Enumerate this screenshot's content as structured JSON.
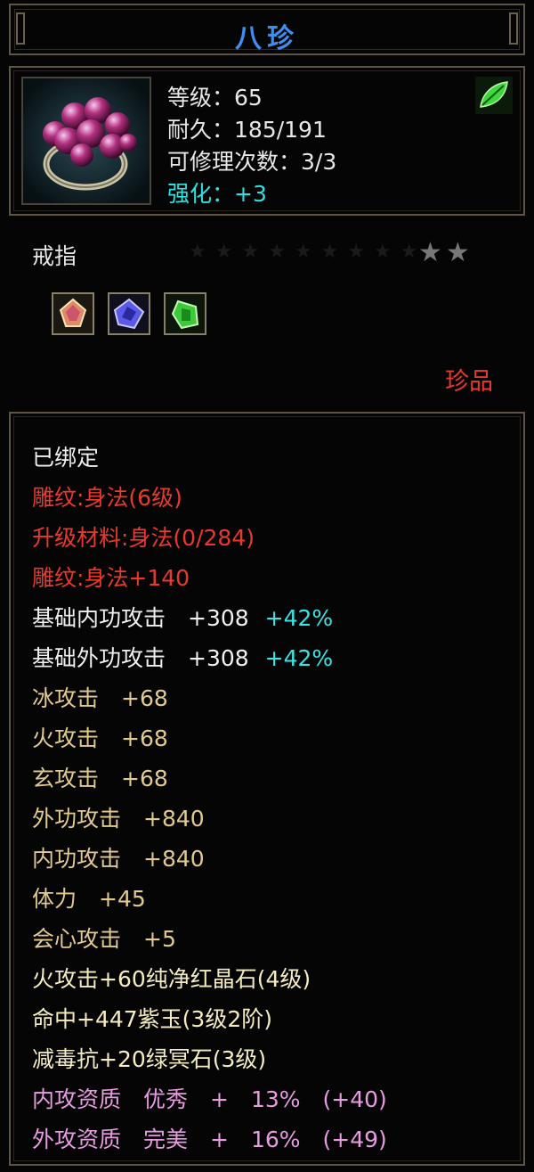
{
  "title": "八珍",
  "header": {
    "item_icon": "purple-pearl-ring-icon",
    "badge_icon": "green-leaf-icon",
    "level": "等级：65",
    "durability": "耐久：185/191",
    "repairs": "可修理次数：3/3",
    "enhance": "强化：+3"
  },
  "item_type": "戒指",
  "stars_filled": 2,
  "stars_text": "★★",
  "gems": [
    "red-gem-icon",
    "blue-gem-icon",
    "green-gem-icon"
  ],
  "rarity": "珍品",
  "attributes": {
    "bound": "已绑定",
    "carving": "雕纹:身法(6级)",
    "upgrade_material": "升级材料:身法(0/284)",
    "carving_bonus": "雕纹:身法+140",
    "base_inner_attack": "基础内功攻击　+308",
    "base_inner_pct": "+42%",
    "base_outer_attack": "基础外功攻击　+308",
    "base_outer_pct": "+42%",
    "ice_attack": "冰攻击　+68",
    "fire_attack": "火攻击　+68",
    "mystic_attack": "玄攻击　+68",
    "outer_attack": "外功攻击　+840",
    "inner_attack": "内功攻击　+840",
    "stamina": "体力　+45",
    "crit_attack": "会心攻击　+5",
    "gem1": "火攻击+60纯净红晶石(4级)",
    "gem2": "命中+447紫玉(3级2阶)",
    "gem3": "减毒抗+20绿冥石(3级)",
    "inner_quality": "内攻资质　优秀　+　13%　(+40)",
    "outer_quality": "外攻资质　完美　+　16%　(+49)"
  },
  "colors": {
    "title": "#3d8ef0",
    "enhance": "#2ee0e0",
    "red": "#e8392c",
    "attribute": "#e2c98e",
    "gem_line": "#f4ecc0",
    "quality": "#e79be0",
    "percent": "#38e4e4",
    "border": "#5e5545"
  }
}
